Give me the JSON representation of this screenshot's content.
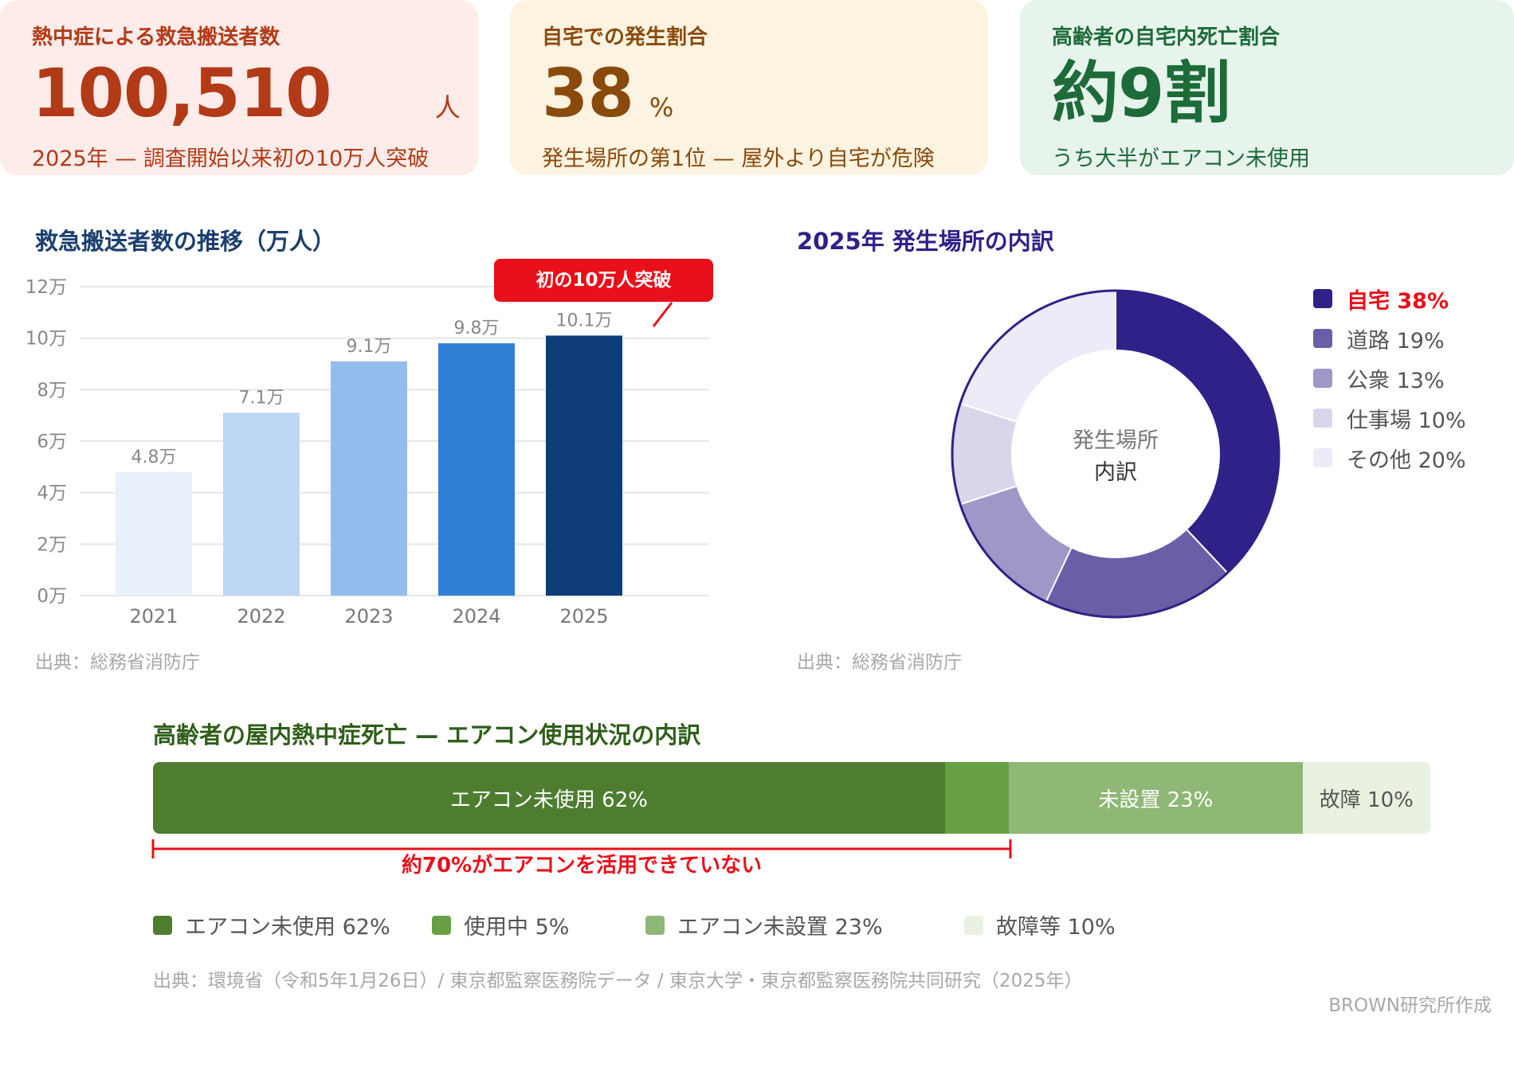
{
  "kpis": [
    {
      "label": "熱中症による救急搬送者数",
      "value": "100,510",
      "unit": "人",
      "sub": "2025年 — 調査開始以来初の10万人突破"
    },
    {
      "label": "自宅での発生割合",
      "value": "38",
      "unit": "%",
      "sub": "発生場所の第1位 — 屋外より自宅が危険"
    },
    {
      "label": "高齢者の自宅内死亡割合",
      "value": "約9割",
      "unit": "",
      "sub": "うち大半がエアコン未使用"
    }
  ],
  "bar_section": {
    "title": "救急搬送者数の推移（万人）",
    "source": "出典：総務省消防庁",
    "callout": "初の10万人突破"
  },
  "pie_section": {
    "title": "2025年 発生場所の内訳",
    "source": "出典：総務省消防庁",
    "center_line1": "発生場所",
    "center_line2": "内訳"
  },
  "stack_section": {
    "title": "高齢者の屋内熱中症死亡 — エアコン使用状況の内訳",
    "bracket_label": "約70%がエアコンを活用できていない",
    "source": "出典：環境省（令和5年1月26日）/ 東京都監察医務院データ / 東京大学・東京都監察医務院共同研究（2025年）"
  },
  "credit": "BROWN研究所作成",
  "chart_data": [
    {
      "type": "bar",
      "title": "救急搬送者数の推移（万人）",
      "categories": [
        "2021",
        "2022",
        "2023",
        "2024",
        "2025"
      ],
      "values": [
        4.8,
        7.1,
        9.1,
        9.8,
        10.1
      ],
      "value_labels": [
        "4.8万",
        "7.1万",
        "9.1万",
        "9.8万",
        "10.1万"
      ],
      "colors": [
        "#e8f0fa",
        "#bcd7f3",
        "#93bdec",
        "#2e7fd6",
        "#0f3d7a"
      ],
      "yticks": [
        "0万",
        "2万",
        "4万",
        "6万",
        "8万",
        "10万",
        "12万"
      ],
      "ylim": [
        0,
        12
      ],
      "grid": true
    },
    {
      "type": "pie",
      "title": "2025年 発生場所の内訳",
      "labels": [
        "自宅 38%",
        "道路 19%",
        "公衆 13%",
        "仕事場 10%",
        "その他 20%"
      ],
      "values": [
        38,
        19,
        13,
        10,
        20
      ],
      "colors": [
        "#2e2288",
        "#6a5fa6",
        "#9e97c8",
        "#d9d6ec",
        "#ecebf8"
      ],
      "legend_position": "right"
    },
    {
      "type": "bar",
      "orientation": "horizontal-stacked",
      "title": "高齢者の屋内熱中症死亡 — エアコン使用状況の内訳",
      "segments": [
        {
          "label": "エアコン未使用 62%",
          "value": 62,
          "color": "#4e7d30",
          "text_color": "#ffffff"
        },
        {
          "label": "",
          "value": 5,
          "color": "#6aa045",
          "text_color": "#ffffff"
        },
        {
          "label": "未設置 23%",
          "value": 23,
          "color": "#8fb775",
          "text_color": "#ffffff"
        },
        {
          "label": "故障 10%",
          "value": 10,
          "color": "#e9f2e0",
          "text_color": "#555555"
        }
      ],
      "legend": [
        {
          "label": "エアコン未使用 62%",
          "color": "#4e7d30"
        },
        {
          "label": "使用中 5%",
          "color": "#6aa045"
        },
        {
          "label": "エアコン未設置 23%",
          "color": "#8fb775"
        },
        {
          "label": "故障等 10%",
          "color": "#e9f2e0"
        }
      ]
    }
  ]
}
